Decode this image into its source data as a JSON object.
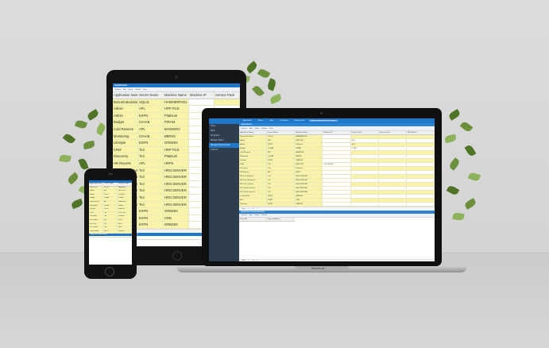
{
  "tablet": {
    "app_title": "Application",
    "toolbar": [
      "Columns",
      "Add",
      "Delete",
      "Refresh",
      "Filter"
    ],
    "columns": [
      "Application Name",
      "Server Name",
      "Machine Name",
      "Machine IP",
      "Service Pack"
    ],
    "rows": [
      [
        "BonusCalculation",
        "SQL01",
        "HAMMERFS01",
        "",
        ""
      ],
      [
        "Admin",
        "APL",
        "HRP FILE",
        "",
        ""
      ],
      [
        "Admin",
        "EXPN",
        "Platinum",
        "",
        ""
      ],
      [
        "Budget",
        "CrmAB",
        "PIRAM",
        "",
        ""
      ],
      [
        "Cold Reserve",
        "APL",
        "BANKERS",
        "",
        ""
      ],
      [
        "Monitoring",
        "CrmAB",
        "BBRS8",
        "",
        ""
      ],
      [
        "Lifestyle",
        "EXPN",
        "GRBS9X",
        "",
        ""
      ],
      [
        "CRM",
        "Tiol",
        "HRP FILE",
        "",
        ""
      ],
      [
        "Discovery",
        "Tiol",
        "Platinum",
        "",
        ""
      ],
      [
        "HR Reports",
        "APL",
        "HRP5",
        "",
        ""
      ],
      [
        "HR Prize Analysis",
        "Tiol",
        "HRG.DENVER",
        "",
        ""
      ],
      [
        "HR Prize Maintainer",
        "Tiol",
        "HRG.DENVER",
        "",
        ""
      ],
      [
        "HR Prize System",
        "Tiol",
        "HRG.DENVER",
        "",
        ""
      ],
      [
        "PLG Health Service",
        "Tiol",
        "HRG.DENVER",
        "",
        ""
      ],
      [
        "PLG Health Service",
        "Tiol",
        "HRG.DENVER",
        "",
        ""
      ],
      [
        "PLG Health Service",
        "Tiol",
        "HRG.DENVER",
        "",
        ""
      ],
      [
        "Lastly Moder",
        "EXPN",
        "GRBS9X",
        "",
        ""
      ],
      [
        "ADV",
        "EXPN",
        "CRB",
        "",
        ""
      ],
      [
        "Planning",
        "EXPN",
        "GRBS9X",
        "",
        ""
      ]
    ],
    "pager": [
      "Page",
      "1",
      "of",
      "5"
    ],
    "bottom_title": "Application Dependencies",
    "bottom_row": "Record ID   RequestedBefore"
  },
  "laptop": {
    "sidebar": [
      "Home",
      "Table",
      "Procedure",
      "Manage Tables",
      "Manage Dependencies",
      "Columns"
    ],
    "sidebar_active_index": 4,
    "nav_tabs": [
      "Application",
      "Server",
      "Table",
      "Procedure",
      "Manage Data",
      "Manage Dependencies Sample"
    ],
    "nav_active_index": 5,
    "pane_title": "Applications",
    "toolbar": [
      "Columns",
      "Add",
      "Delete",
      "Refresh",
      "Filter"
    ],
    "columns": [
      "Application Name",
      "Server Name",
      "Machine Name",
      "Machine IP",
      "Service Pack",
      "Service Pack",
      "DB Platform"
    ],
    "rows": [
      [
        "BonusCalculation",
        "SQL01",
        "HAMMERFS01",
        "",
        "",
        "",
        ""
      ],
      [
        "Admin",
        "APL",
        "HRP FILE",
        "",
        "SQL",
        "",
        ""
      ],
      [
        "Admin",
        "EXPN",
        "Platinum",
        "",
        "SQL",
        "",
        ""
      ],
      [
        "Budget",
        "CrmAB",
        "PIRAM",
        "",
        "CORE",
        "",
        ""
      ],
      [
        "Cold Reserve",
        "APL",
        "BANKERS",
        "",
        "",
        "",
        ""
      ],
      [
        "Monitoring",
        "CrmAB",
        "BBRS8",
        "",
        "",
        "",
        ""
      ],
      [
        "Lifestyle",
        "EXPN",
        "GRBS9X",
        "",
        "",
        "",
        ""
      ],
      [
        "CRM",
        "Tiol",
        "HRP FILE",
        "123.185.48.1",
        "",
        "",
        ""
      ],
      [
        "Discovery",
        "Tiol",
        "Platinum",
        "",
        "",
        "",
        ""
      ],
      [
        "HR Reports",
        "APL",
        "HRP5",
        "",
        "",
        "",
        ""
      ],
      [
        "HR Prize Analysis",
        "Tiol",
        "HRG.DENVER",
        "",
        "",
        "",
        ""
      ],
      [
        "HR Prize Maintainer",
        "Tiol",
        "HRG.DENVER",
        "",
        "",
        "",
        ""
      ],
      [
        "HR Prize System",
        "Tiol",
        "HRG.DENVER",
        "",
        "",
        "",
        ""
      ],
      [
        "PLG Health Service",
        "Tiol",
        "HRG.DENVER",
        "",
        "",
        "",
        ""
      ],
      [
        "PLG Health Service",
        "Tiol",
        "HRG.DENVER",
        "",
        "",
        "",
        ""
      ],
      [
        "Lastly Moder",
        "EXPN",
        "GRBS9X",
        "",
        "",
        "",
        ""
      ],
      [
        "ADV",
        "EXPN",
        "CRB",
        "",
        "",
        "",
        ""
      ],
      [
        "Planning",
        "EXPN",
        "GRBS9X",
        "",
        "",
        "",
        ""
      ]
    ],
    "pager": [
      "Page",
      "1",
      "of",
      "5"
    ],
    "bottom_title": "Application Dependencies",
    "bottom_toolbar": [
      "Columns",
      "Add",
      "Delete",
      "Refresh"
    ],
    "bottom_columns": [
      "Record ID",
      "RequestedBefore"
    ],
    "bottom_pager": [
      "Page",
      "1",
      "of",
      "1"
    ],
    "brand": "MacBook"
  },
  "phone": {
    "columns": [
      "Application Name",
      "Server Name",
      "Machine Name"
    ],
    "rows": [
      [
        "BonusCalc",
        "SQL01",
        "HAMMER"
      ],
      [
        "Admin",
        "APL",
        "HRP FILE"
      ],
      [
        "Admin",
        "EXPN",
        "Platinum"
      ],
      [
        "Budget",
        "CrmAB",
        "PIRAM"
      ],
      [
        "Cold Reserve",
        "APL",
        "BANKERS"
      ],
      [
        "Monitoring",
        "CrmAB",
        "BBRS8"
      ],
      [
        "Lifestyle",
        "EXPN",
        "GRBS9X"
      ],
      [
        "CRM",
        "Tiol",
        "HRP FILE"
      ],
      [
        "Discovery",
        "Tiol",
        "Platinum"
      ],
      [
        "HR Reports",
        "APL",
        "HRP5"
      ],
      [
        "HR Prize",
        "Tiol",
        "HRG"
      ],
      [
        "PLG Health",
        "Tiol",
        "HRG"
      ],
      [
        "Lastly Moder",
        "EXPN",
        "GRBS9X"
      ]
    ],
    "bottom_title": "Application Dependencies",
    "bottom_row": "Record ID   RequestedBefore"
  }
}
